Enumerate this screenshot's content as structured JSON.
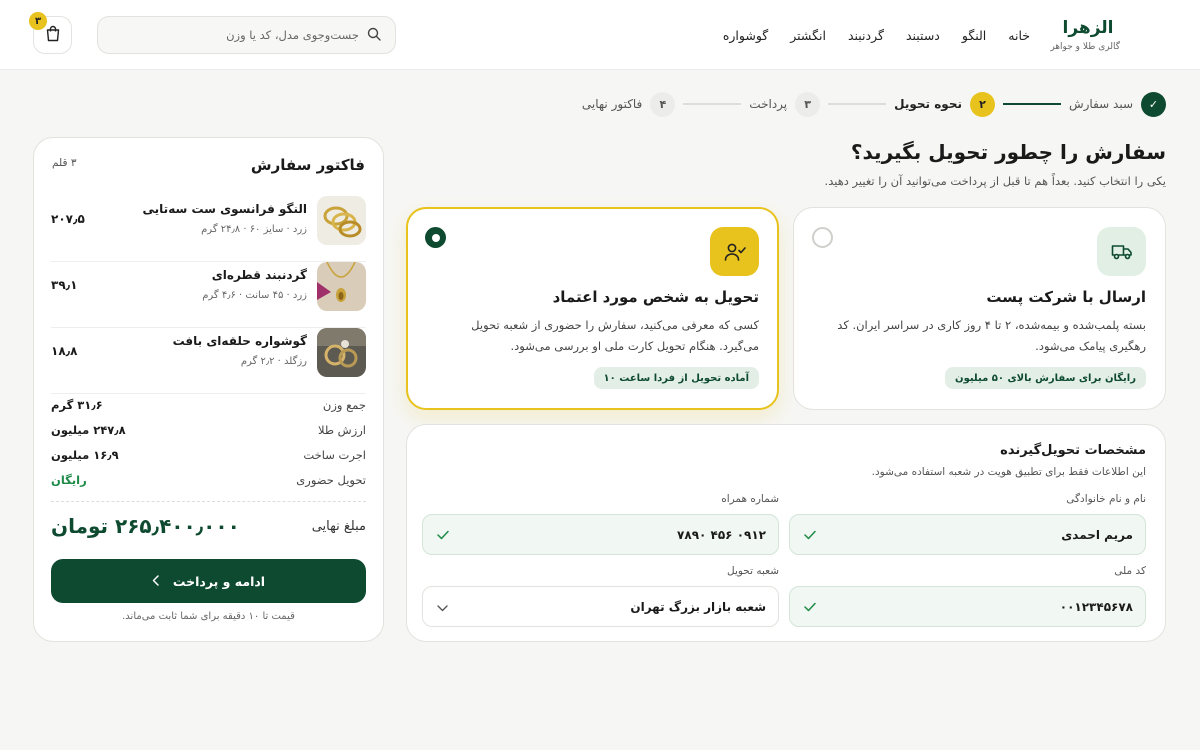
{
  "brand": {
    "name": "الزهرا",
    "tagline": "گالری طلا و جواهر",
    "accent": "#0d4a2f",
    "gold": "#e8c21d"
  },
  "nav": [
    "خانه",
    "النگو",
    "دستبند",
    "گردنبند",
    "انگشتر",
    "گوشواره"
  ],
  "search": {
    "placeholder": "جست‌وجوی مدل، کد یا وزن",
    "icon": "search-icon"
  },
  "cart": {
    "count": "۳",
    "icon": "shopping-bag-icon"
  },
  "steps": [
    {
      "num": "✓",
      "label": "سبد سفارش",
      "state": "done"
    },
    {
      "num": "۲",
      "label": "نحوه تحویل",
      "state": "active"
    },
    {
      "num": "۳",
      "label": "پرداخت",
      "state": "todo"
    },
    {
      "num": "۴",
      "label": "فاکتور نهایی",
      "state": "todo"
    }
  ],
  "page": {
    "title": "سفارش را چطور تحویل بگیرید؟",
    "subtitle": "یکی را انتخاب کنید. بعداً هم تا قبل از پرداخت می‌توانید آن را تغییر دهید."
  },
  "options": {
    "post": {
      "title": "ارسال با شرکت پست",
      "desc": "بسته پلمب‌شده و بیمه‌شده، ۲ تا ۴ روز کاری در سراسر ایران. کد رهگیری پیامک می‌شود.",
      "tag": "رایگان برای سفارش بالای ۵۰ میلیون",
      "icon": "truck-icon",
      "selected": false
    },
    "person": {
      "title": "تحویل به شخص مورد اعتماد",
      "desc": "کسی که معرفی می‌کنید، سفارش را حضوری از شعبه تحویل می‌گیرد. هنگام تحویل کارت ملی او بررسی می‌شود.",
      "tag": "آماده تحویل از فردا ساعت ۱۰",
      "icon": "user-check-icon",
      "selected": true
    }
  },
  "recipient": {
    "title": "مشخصات تحویل‌گیرنده",
    "subtitle": "این اطلاعات فقط برای تطبیق هویت در شعبه استفاده می‌شود.",
    "fields": {
      "name": {
        "label": "نام و نام خانوادگی",
        "value": "مریم احمدی"
      },
      "phone": {
        "label": "شماره همراه",
        "value": "۰۹۱۲ ۴۵۶ ۷۸۹۰"
      },
      "national_id": {
        "label": "کد ملی",
        "value": "۰۰۱۲۳۴۵۶۷۸"
      },
      "branch": {
        "label": "شعبه تحویل",
        "value": "شعبه بازار بزرگ تهران"
      }
    }
  },
  "invoice": {
    "title": "فاکتور سفارش",
    "count": "۳ قلم",
    "items": [
      {
        "name": "النگو فرانسوی ست سه‌تایی",
        "meta": "زرد · سایز ۶۰ · ۲۴٫۸ گرم",
        "price": "۲۰۷٫۵"
      },
      {
        "name": "گردنبند قطره‌ای",
        "meta": "زرد · ۴۵ سانت · ۴٫۶ گرم",
        "price": "۳۹٫۱"
      },
      {
        "name": "گوشواره حلقه‌ای بافت",
        "meta": "رزگلد · ۲٫۲ گرم",
        "price": "۱۸٫۸"
      }
    ],
    "summary": [
      {
        "k": "جمع وزن",
        "v": "۳۱٫۶ گرم"
      },
      {
        "k": "ارزش طلا",
        "v": "۲۴۷٫۸ میلیون"
      },
      {
        "k": "اجرت ساخت",
        "v": "۱۶٫۹ میلیون"
      },
      {
        "k": "تحویل حضوری",
        "v": "رایگان"
      }
    ],
    "final_label": "مبلغ نهایی",
    "final_value": "۲۶۵٫۴۰۰٫۰۰۰ تومان",
    "cta": "ادامه و پرداخت",
    "note": "قیمت تا ۱۰ دقیقه برای شما ثابت می‌ماند."
  }
}
